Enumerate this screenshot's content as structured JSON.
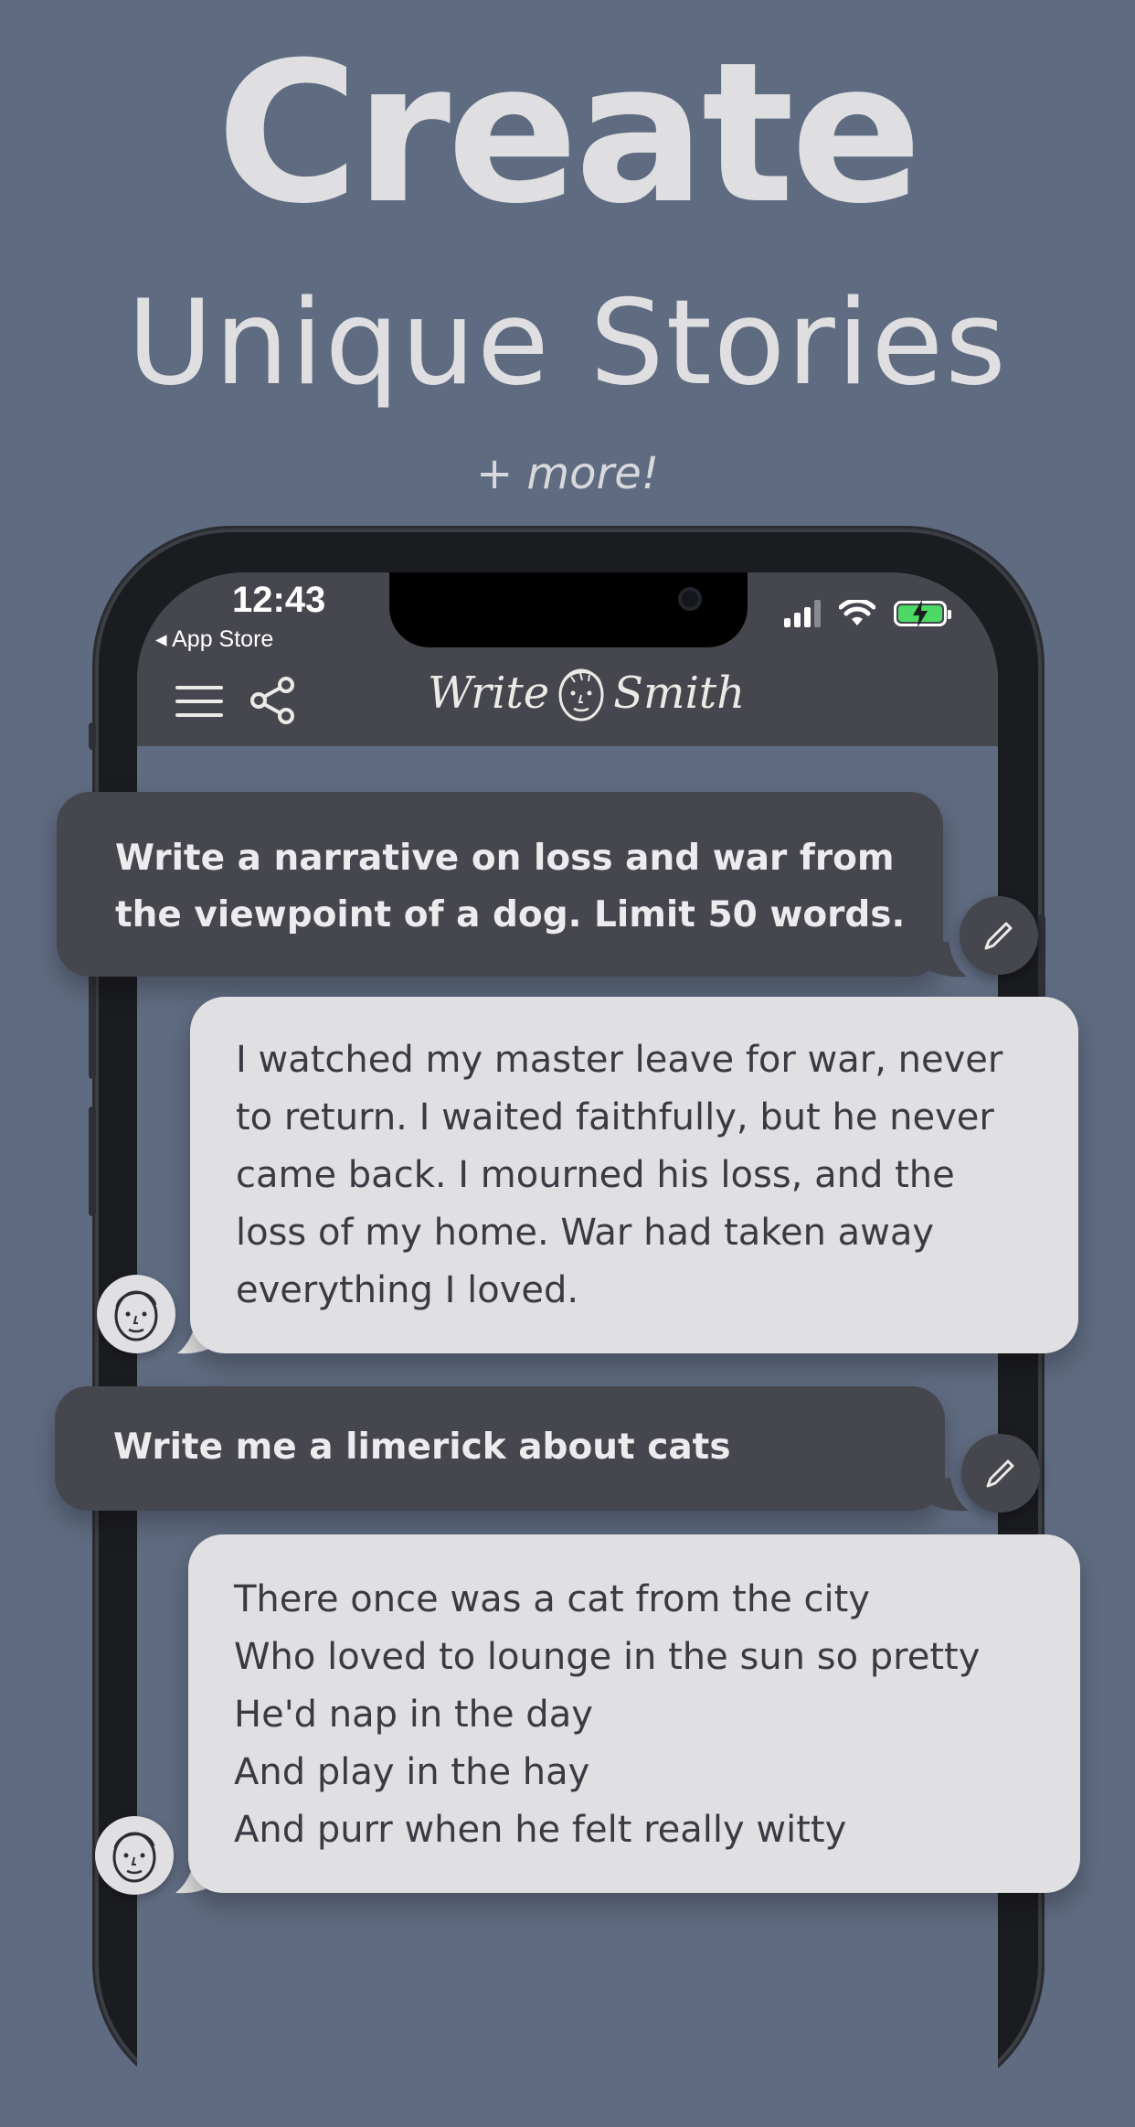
{
  "headline": {
    "title": "Create",
    "subtitle": "Unique Stories",
    "tagline": "+ more!"
  },
  "status_bar": {
    "time": "12:43",
    "back_label": "◂ App Store"
  },
  "app": {
    "logo_left": "Write",
    "logo_right": "Smith",
    "icons": [
      "menu-icon",
      "share-icon",
      "pencil-icon",
      "face-icon"
    ]
  },
  "messages": [
    {
      "role": "user",
      "lines": [
        "Write a narrative on loss and war from",
        "the viewpoint of a dog. Limit 50 words."
      ]
    },
    {
      "role": "assistant",
      "lines": [
        "I watched my master leave for war, never",
        "to return. I waited faithfully, but he never",
        "came back. I mourned his loss, and the",
        "loss of my home. War had taken away",
        "everything I loved."
      ]
    },
    {
      "role": "user",
      "lines": [
        "Write me a limerick about cats"
      ]
    },
    {
      "role": "assistant",
      "lines": [
        "There once was a cat from the city",
        "Who loved to lounge in the sun so pretty",
        "He'd nap in the day",
        "And play in the hay",
        "And purr when he felt really witty"
      ]
    }
  ],
  "colors": {
    "background": "#5f6b80",
    "user_bubble": "#46464f",
    "assistant_bubble": "#e0e0e2",
    "battery": "#4cd964"
  }
}
